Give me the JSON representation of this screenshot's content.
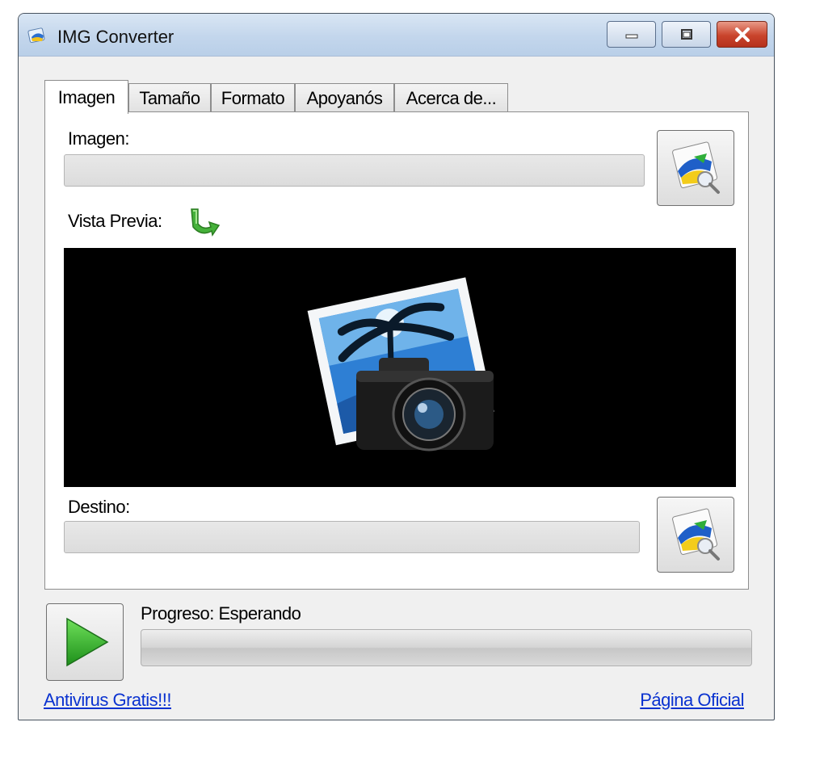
{
  "window": {
    "title": "IMG Converter"
  },
  "tabs": [
    {
      "label": "Imagen"
    },
    {
      "label": "Tamaño"
    },
    {
      "label": "Formato"
    },
    {
      "label": "Apoyanós"
    },
    {
      "label": "Acerca de..."
    }
  ],
  "imagen_tab": {
    "image_label": "Imagen:",
    "image_value": "",
    "preview_label": "Vista Previa:",
    "destination_label": "Destino:",
    "destination_value": ""
  },
  "progress": {
    "label": "Progreso: Esperando",
    "fraction": 0
  },
  "links": {
    "antivirus": "Antivirus Gratis!!!",
    "official": "Página Oficial"
  },
  "colors": {
    "titlebar": "#c3d6ec",
    "close": "#c9442c",
    "link": "#0a32d0",
    "preview_bg": "#000000"
  },
  "icons": [
    "app-icon",
    "minimize-icon",
    "maximize-icon",
    "close-icon",
    "browse-image-icon",
    "refresh-arrow-icon",
    "photo-camera-icon",
    "play-icon"
  ]
}
